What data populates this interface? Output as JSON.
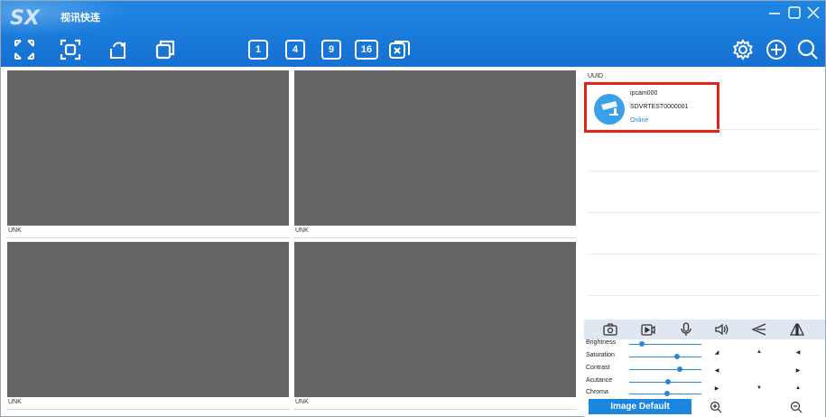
{
  "app": {
    "title": "视讯快连",
    "logo": "SX"
  },
  "window_controls": [
    "minimize-icon",
    "maximize-icon",
    "close-icon"
  ],
  "toolbar": {
    "left_icons": [
      "fullscreen-icon",
      "capture-frame-icon",
      "rotate-icon",
      "copy-window-icon"
    ],
    "screen_layouts": [
      "1",
      "4",
      "9",
      "16"
    ],
    "close_all_icon": "close-square-icon",
    "right_icons": [
      "gear-icon",
      "add-icon",
      "search-icon"
    ]
  },
  "video_panes": [
    {
      "label": "UNK"
    },
    {
      "label": "UNK"
    },
    {
      "label": "UNK"
    },
    {
      "label": "UNK"
    }
  ],
  "device_list": {
    "header": "UUID",
    "devices": [
      {
        "name": "ipcam000",
        "uid": "SDVRTEST0000001",
        "status": "Online"
      }
    ]
  },
  "control_bar": [
    "camera-icon",
    "record-icon",
    "microphone-icon",
    "speaker-icon",
    "send-icon",
    "mirror-icon"
  ],
  "image_adjust": {
    "rows": [
      {
        "label": "Brightness",
        "level": 0.18
      },
      {
        "label": "Saturation",
        "level": 0.66
      },
      {
        "label": "Contrast",
        "level": 0.7
      },
      {
        "label": "Acutance",
        "level": 0.54
      },
      {
        "label": "Chroma",
        "level": 0.52
      }
    ],
    "default_button": "Image Default",
    "zoom_in_icon": "zoom-in-icon",
    "zoom_out_icon": "zoom-out-icon"
  },
  "colors": {
    "titlebar": "#1a7ddc",
    "accent": "#2a86d8",
    "highlight": "#e2231a",
    "video_bg": "#666666"
  }
}
